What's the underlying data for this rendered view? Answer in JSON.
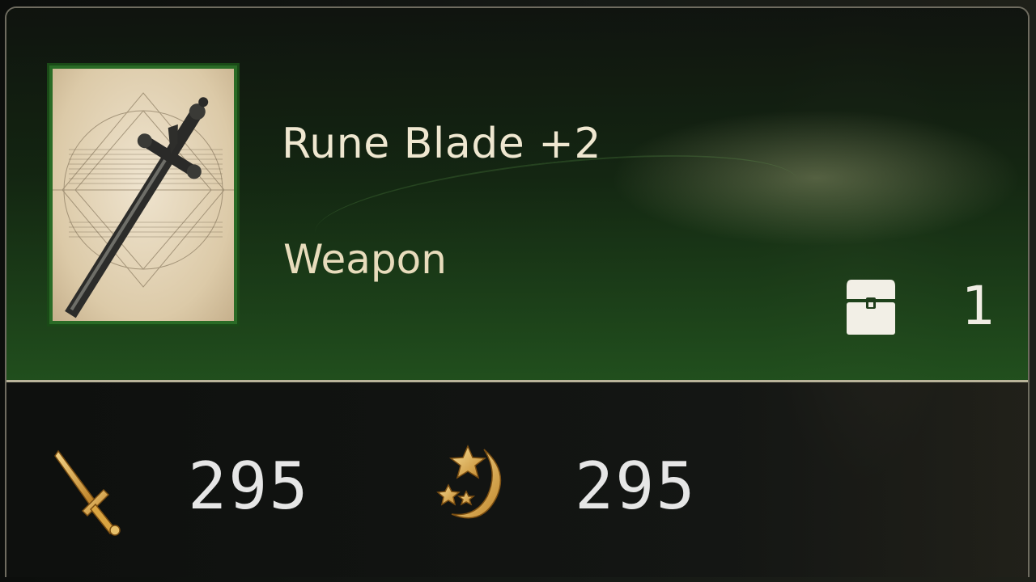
{
  "item": {
    "name": "Rune Blade +2",
    "type": "Weapon",
    "image": "rune-blade-sword-sketch",
    "frame_color": "#2a6b26"
  },
  "owned": {
    "icon": "treasure-chest-icon",
    "count": "1"
  },
  "stats": [
    {
      "icon": "sword-icon",
      "value": "295"
    },
    {
      "icon": "stars-ring-icon",
      "value": "295"
    }
  ],
  "colors": {
    "accent_green": "#2a6b26",
    "gold": "#d9a441",
    "text": "#efe7d0"
  }
}
